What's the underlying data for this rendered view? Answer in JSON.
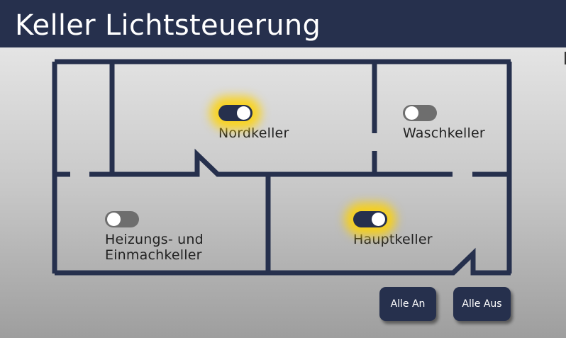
{
  "header": {
    "title": "Keller Lichtsteuerung"
  },
  "rooms": {
    "nordkeller": {
      "label": "Nordkeller",
      "light_on": true
    },
    "waschkeller": {
      "label": "Waschkeller",
      "light_on": false
    },
    "heizungskeller": {
      "label": "Heizungs- und\nEinmachkeller",
      "light_on": false
    },
    "hauptkeller": {
      "label": "Hauptkeller",
      "light_on": true
    }
  },
  "buttons": {
    "all_on": "Alle An",
    "all_off": "Alle Aus"
  },
  "colors": {
    "header": "#26304d",
    "walls": "#26304d",
    "glow": "#ffd200",
    "toggle_off": "#6e6e6e"
  }
}
